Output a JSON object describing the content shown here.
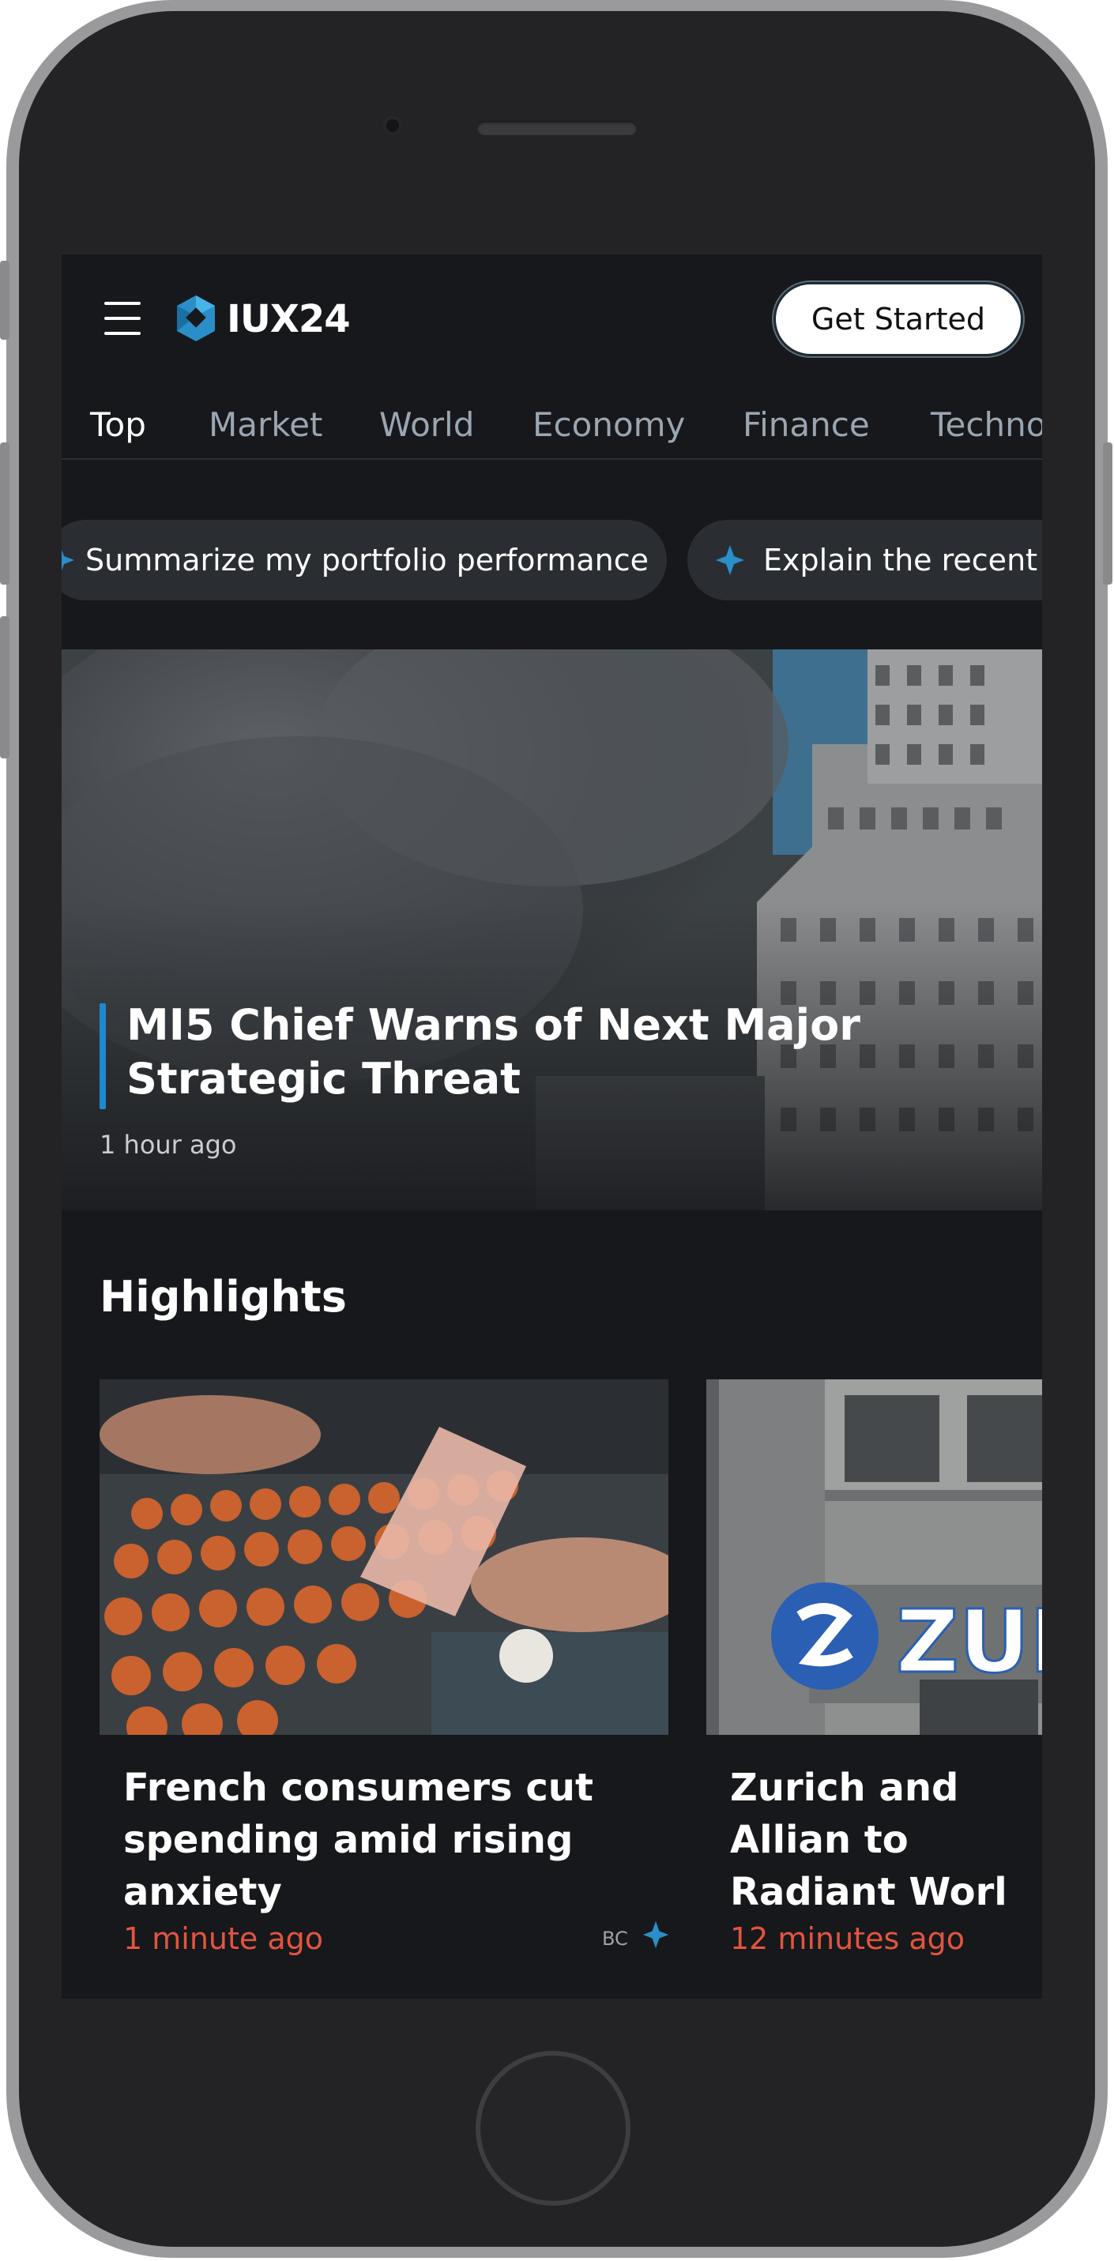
{
  "header": {
    "brand": "IUX24",
    "get_started": "Get Started"
  },
  "tabs": [
    "Top",
    "Market",
    "World",
    "Economy",
    "Finance",
    "Techno"
  ],
  "suggestions": [
    "Summarize my portfolio performance",
    "Explain the recent d"
  ],
  "hero": {
    "title": "MI5 Chief Warns of Next Major Strategic Threat",
    "time": "1 hour ago"
  },
  "highlights": {
    "title": "Highlights",
    "cards": [
      {
        "title": "French consumers cut spending amid rising anxiety",
        "time": "1 minute ago",
        "source": "BC"
      },
      {
        "title": "Zurich and Allian to Radiant Worl",
        "time": "12 minutes ago"
      }
    ]
  },
  "colors": {
    "accent": "#1d8ad0",
    "time_red": "#e2553f",
    "screen_bg": "#17181b"
  },
  "icons": [
    "menu-icon",
    "logo-icon",
    "sparkle-icon"
  ]
}
